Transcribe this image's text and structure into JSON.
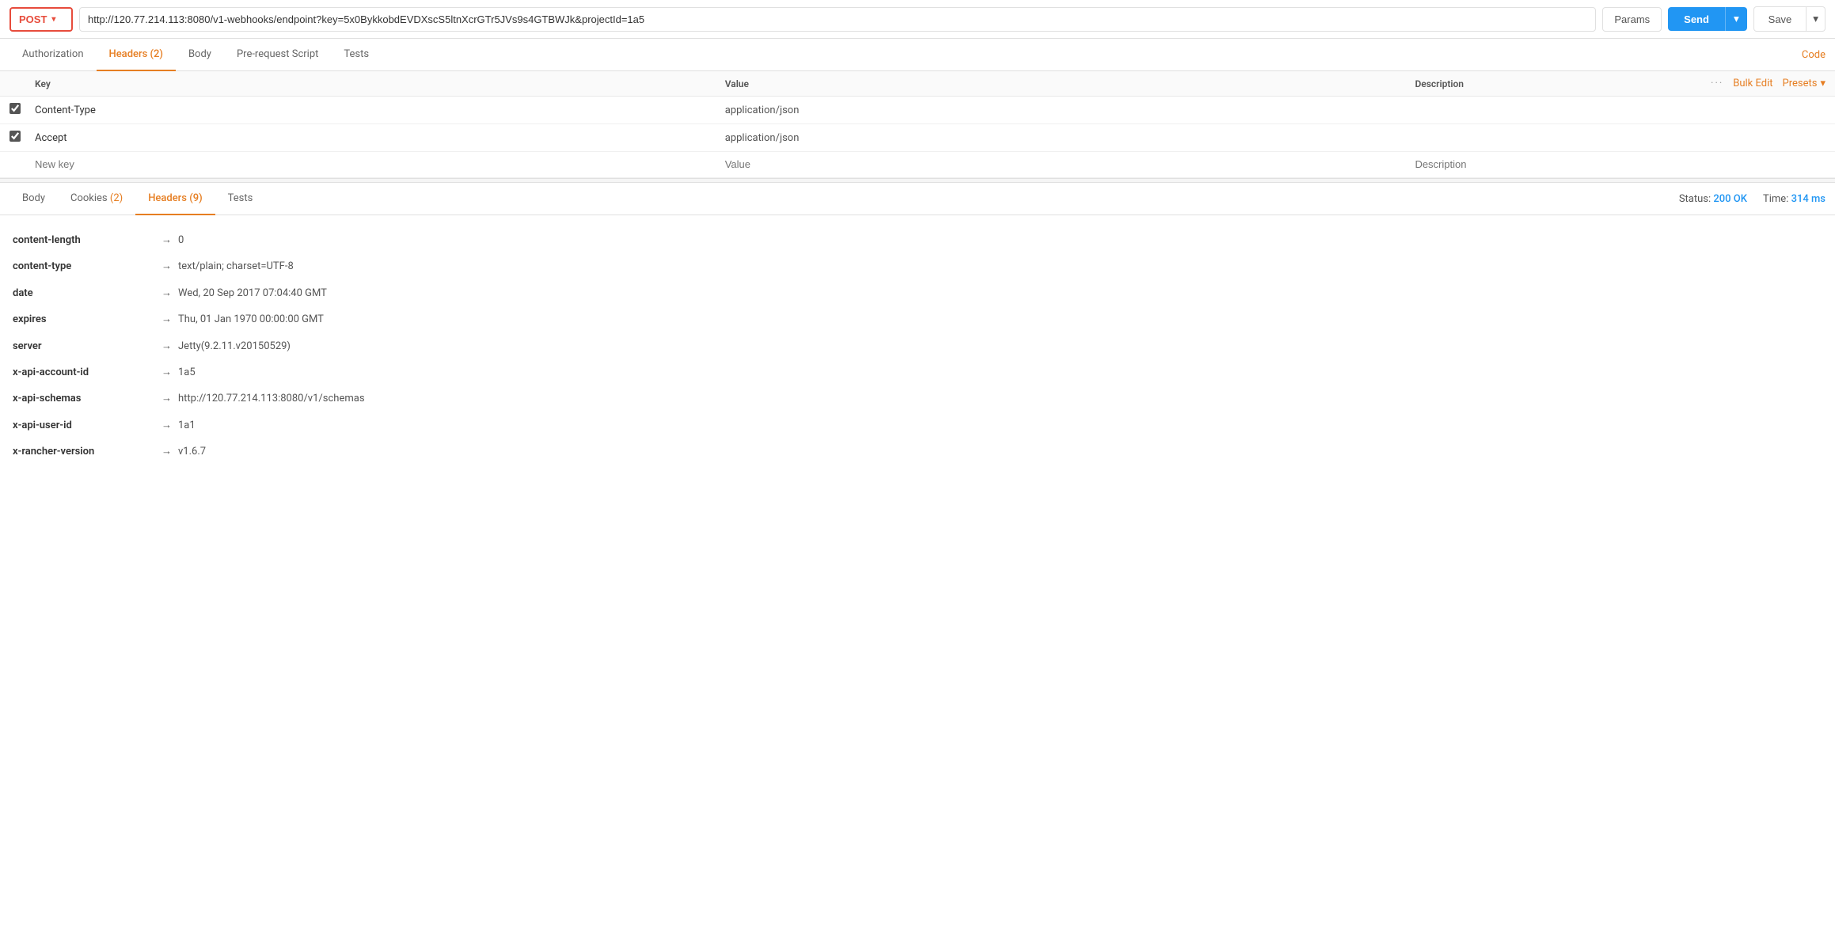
{
  "topbar": {
    "method": "POST",
    "url": "http://120.77.214.113:8080/v1-webhooks/endpoint?key=5x0BykkobdEVDXscS5ltnXcrGTr5JVs9s4GTBWJk&projectId=1a5",
    "params_label": "Params",
    "send_label": "Send",
    "save_label": "Save"
  },
  "request_tabs": [
    {
      "label": "Authorization",
      "badge": null,
      "active": false
    },
    {
      "label": "Headers",
      "badge": "(2)",
      "active": true
    },
    {
      "label": "Body",
      "badge": null,
      "active": false
    },
    {
      "label": "Pre-request Script",
      "badge": null,
      "active": false
    },
    {
      "label": "Tests",
      "badge": null,
      "active": false
    }
  ],
  "code_label": "Code",
  "headers_table": {
    "columns": [
      "Key",
      "Value",
      "Description"
    ],
    "bulk_edit_label": "Bulk Edit",
    "presets_label": "Presets",
    "rows": [
      {
        "checked": true,
        "key": "Content-Type",
        "value": "application/json",
        "description": ""
      },
      {
        "checked": true,
        "key": "Accept",
        "value": "application/json",
        "description": ""
      }
    ],
    "new_row": {
      "key_placeholder": "New key",
      "value_placeholder": "Value",
      "desc_placeholder": "Description"
    }
  },
  "response_tabs": [
    {
      "label": "Body",
      "badge": null,
      "active": false
    },
    {
      "label": "Cookies",
      "badge": "(2)",
      "active": false
    },
    {
      "label": "Headers",
      "badge": "(9)",
      "active": true
    },
    {
      "label": "Tests",
      "badge": null,
      "active": false
    }
  ],
  "response_status": {
    "status_label": "Status:",
    "status_value": "200 OK",
    "time_label": "Time:",
    "time_value": "314 ms"
  },
  "response_headers": [
    {
      "key": "content-length",
      "value": "0"
    },
    {
      "key": "content-type",
      "value": "text/plain; charset=UTF-8"
    },
    {
      "key": "date",
      "value": "Wed, 20 Sep 2017 07:04:40 GMT"
    },
    {
      "key": "expires",
      "value": "Thu, 01 Jan 1970 00:00:00 GMT"
    },
    {
      "key": "server",
      "value": "Jetty(9.2.11.v20150529)"
    },
    {
      "key": "x-api-account-id",
      "value": "1a5"
    },
    {
      "key": "x-api-schemas",
      "value": "http://120.77.214.113:8080/v1/schemas"
    },
    {
      "key": "x-api-user-id",
      "value": "1a1"
    },
    {
      "key": "x-rancher-version",
      "value": "v1.6.7"
    }
  ],
  "colors": {
    "orange": "#e67e22",
    "blue": "#2196F3",
    "red_border": "#e74c3c"
  }
}
